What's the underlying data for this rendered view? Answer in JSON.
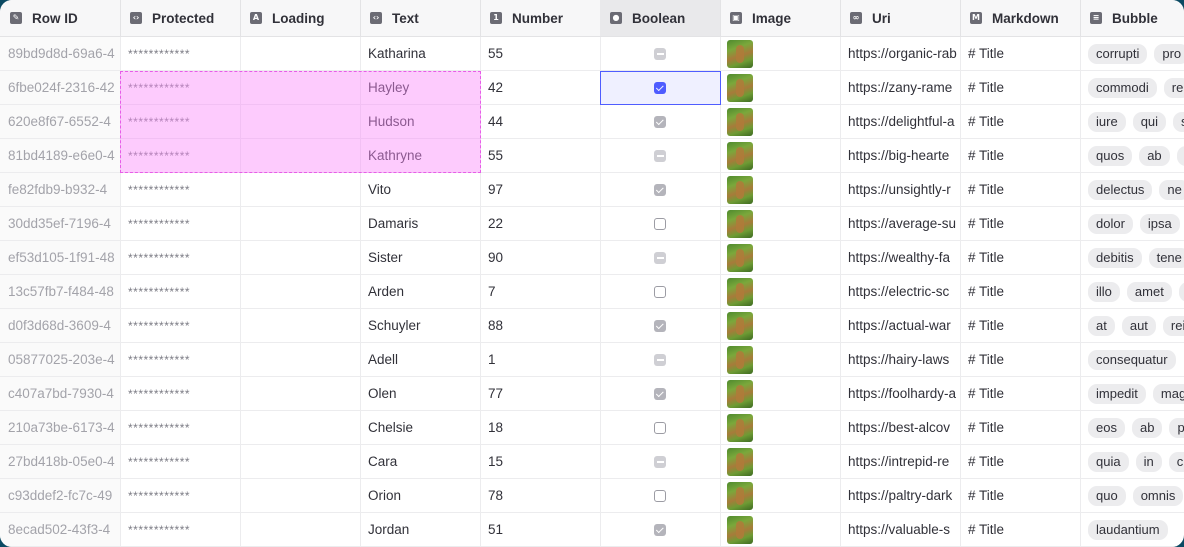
{
  "columns": [
    {
      "label": "Row ID",
      "icon": "edit-icon"
    },
    {
      "label": "Protected",
      "icon": "code-icon"
    },
    {
      "label": "Loading",
      "icon": "text-icon"
    },
    {
      "label": "Text",
      "icon": "code-icon"
    },
    {
      "label": "Number",
      "icon": "number-icon"
    },
    {
      "label": "Boolean",
      "icon": "toggle-icon"
    },
    {
      "label": "Image",
      "icon": "image-icon"
    },
    {
      "label": "Uri",
      "icon": "link-icon"
    },
    {
      "label": "Markdown",
      "icon": "markdown-icon"
    },
    {
      "label": "Bubble",
      "icon": "list-icon"
    }
  ],
  "rows": [
    {
      "id": "89bd9d8d-69a6-4",
      "protected": "************",
      "text": "Katharina",
      "number": "55",
      "bool": "indeterminate",
      "uri": "https://organic-rab",
      "markdown": "# Title",
      "bubbles": [
        "corrupti",
        "pro"
      ]
    },
    {
      "id": "6fbe024f-2316-42",
      "protected": "************",
      "text": "Hayley",
      "number": "42",
      "bool": "checked",
      "uri": "https://zany-rame",
      "markdown": "# Title",
      "bubbles": [
        "commodi",
        "re"
      ]
    },
    {
      "id": "620e8f67-6552-4",
      "protected": "************",
      "text": "Hudson",
      "number": "44",
      "bool": "checked",
      "uri": "https://delightful-a",
      "markdown": "# Title",
      "bubbles": [
        "iure",
        "qui",
        "s"
      ]
    },
    {
      "id": "81bd4189-e6e0-4",
      "protected": "************",
      "text": "Kathryne",
      "number": "55",
      "bool": "indeterminate",
      "uri": "https://big-hearte",
      "markdown": "# Title",
      "bubbles": [
        "quos",
        "ab",
        "f"
      ]
    },
    {
      "id": "fe82fdb9-b932-4",
      "protected": "************",
      "text": "Vito",
      "number": "97",
      "bool": "checked",
      "uri": "https://unsightly-r",
      "markdown": "# Title",
      "bubbles": [
        "delectus",
        "ne"
      ]
    },
    {
      "id": "30dd35ef-7196-4",
      "protected": "************",
      "text": "Damaris",
      "number": "22",
      "bool": "unchecked",
      "uri": "https://average-su",
      "markdown": "# Title",
      "bubbles": [
        "dolor",
        "ipsa"
      ]
    },
    {
      "id": "ef53d105-1f91-48",
      "protected": "************",
      "text": "Sister",
      "number": "90",
      "bool": "indeterminate",
      "uri": "https://wealthy-fa",
      "markdown": "# Title",
      "bubbles": [
        "debitis",
        "tene"
      ]
    },
    {
      "id": "13c57fb7-f484-48",
      "protected": "************",
      "text": "Arden",
      "number": "7",
      "bool": "unchecked",
      "uri": "https://electric-sc",
      "markdown": "# Title",
      "bubbles": [
        "illo",
        "amet",
        "c"
      ]
    },
    {
      "id": "d0f3d68d-3609-4",
      "protected": "************",
      "text": "Schuyler",
      "number": "88",
      "bool": "checked",
      "uri": "https://actual-war",
      "markdown": "# Title",
      "bubbles": [
        "at",
        "aut",
        "rei"
      ]
    },
    {
      "id": "05877025-203e-4",
      "protected": "************",
      "text": "Adell",
      "number": "1",
      "bool": "indeterminate",
      "uri": "https://hairy-laws",
      "markdown": "# Title",
      "bubbles": [
        "consequatur"
      ]
    },
    {
      "id": "c407a7bd-7930-4",
      "protected": "************",
      "text": "Olen",
      "number": "77",
      "bool": "checked",
      "uri": "https://foolhardy-a",
      "markdown": "# Title",
      "bubbles": [
        "impedit",
        "mag"
      ]
    },
    {
      "id": "210a73be-6173-4",
      "protected": "************",
      "text": "Chelsie",
      "number": "18",
      "bool": "unchecked",
      "uri": "https://best-alcov",
      "markdown": "# Title",
      "bubbles": [
        "eos",
        "ab",
        "pe"
      ]
    },
    {
      "id": "27bd418b-05e0-4",
      "protected": "************",
      "text": "Cara",
      "number": "15",
      "bool": "indeterminate",
      "uri": "https://intrepid-re",
      "markdown": "# Title",
      "bubbles": [
        "quia",
        "in",
        "cu"
      ]
    },
    {
      "id": "c93ddef2-fc7c-49",
      "protected": "************",
      "text": "Orion",
      "number": "78",
      "bool": "unchecked",
      "uri": "https://paltry-dark",
      "markdown": "# Title",
      "bubbles": [
        "quo",
        "omnis"
      ]
    },
    {
      "id": "8ecad502-43f3-4",
      "protected": "************",
      "text": "Jordan",
      "number": "51",
      "bool": "checked",
      "uri": "https://valuable-s",
      "markdown": "# Title",
      "bubbles": [
        "laudantium"
      ]
    }
  ],
  "colors": {
    "selection_fill": "#fa8cfa",
    "focus_border": "#4f5dff",
    "checkbox_checked": "#b4b4bb"
  }
}
